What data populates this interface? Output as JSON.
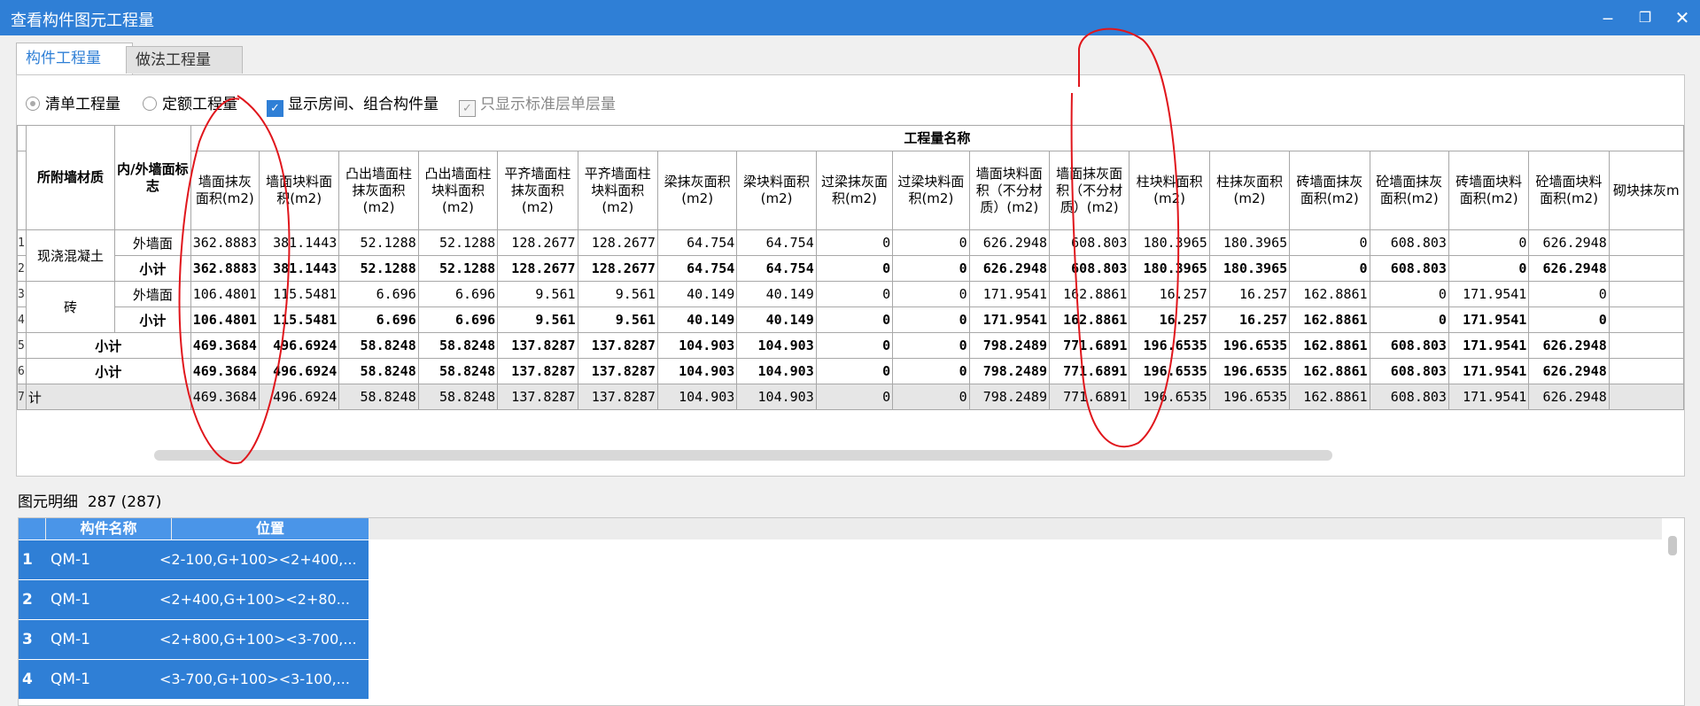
{
  "window": {
    "title": "查看构件图元工程量"
  },
  "tabs": [
    {
      "label": "构件工程量",
      "active": true
    },
    {
      "label": "做法工程量",
      "active": false
    }
  ],
  "options": {
    "radio1": "清单工程量",
    "radio2": "定额工程量",
    "check1": "显示房间、组合构件量",
    "check2": "只显示标准层单层量"
  },
  "table": {
    "group_header": "工程量名称",
    "col_material": "所附墙材质",
    "col_side": "内/外墙面标志",
    "columns": [
      "墙面抹灰面积(m2)",
      "墙面块料面积(m2)",
      "凸出墙面柱抹灰面积(m2)",
      "凸出墙面柱块料面积(m2)",
      "平齐墙面柱抹灰面积(m2)",
      "平齐墙面柱块料面积(m2)",
      "梁抹灰面积(m2)",
      "梁块料面积(m2)",
      "过梁抹灰面积(m2)",
      "过梁块料面积(m2)",
      "墙面块料面积（不分材质）(m2)",
      "墙面抹灰面积（不分材质）(m2)",
      "柱块料面积(m2)",
      "柱抹灰面积(m2)",
      "砖墙面抹灰面积(m2)",
      "砼墙面抹灰面积(m2)",
      "砖墙面块料面积(m2)",
      "砼墙面块料面积(m2)",
      "砌块抹灰m"
    ],
    "rows": [
      {
        "n": "1",
        "material": "现浇混凝土",
        "side": "外墙面",
        "values": [
          "362.8883",
          "381.1443",
          "52.1288",
          "52.1288",
          "128.2677",
          "128.2677",
          "64.754",
          "64.754",
          "0",
          "0",
          "626.2948",
          "608.803",
          "180.3965",
          "180.3965",
          "0",
          "608.803",
          "0",
          "626.2948",
          ""
        ]
      },
      {
        "n": "2",
        "material": "",
        "side": "小计",
        "values": [
          "362.8883",
          "381.1443",
          "52.1288",
          "52.1288",
          "128.2677",
          "128.2677",
          "64.754",
          "64.754",
          "0",
          "0",
          "626.2948",
          "608.803",
          "180.3965",
          "180.3965",
          "0",
          "608.803",
          "0",
          "626.2948",
          ""
        ]
      },
      {
        "n": "3",
        "material": "砖",
        "side": "外墙面",
        "values": [
          "106.4801",
          "115.5481",
          "6.696",
          "6.696",
          "9.561",
          "9.561",
          "40.149",
          "40.149",
          "0",
          "0",
          "171.9541",
          "162.8861",
          "16.257",
          "16.257",
          "162.8861",
          "0",
          "171.9541",
          "0",
          ""
        ]
      },
      {
        "n": "4",
        "material": "",
        "side": "小计",
        "values": [
          "106.4801",
          "115.5481",
          "6.696",
          "6.696",
          "9.561",
          "9.561",
          "40.149",
          "40.149",
          "0",
          "0",
          "171.9541",
          "162.8861",
          "16.257",
          "16.257",
          "162.8861",
          "0",
          "171.9541",
          "0",
          ""
        ]
      },
      {
        "n": "5",
        "label": "小计",
        "values": [
          "469.3684",
          "496.6924",
          "58.8248",
          "58.8248",
          "137.8287",
          "137.8287",
          "104.903",
          "104.903",
          "0",
          "0",
          "798.2489",
          "771.6891",
          "196.6535",
          "196.6535",
          "162.8861",
          "608.803",
          "171.9541",
          "626.2948",
          ""
        ]
      },
      {
        "n": "6",
        "label": "小计",
        "values": [
          "469.3684",
          "496.6924",
          "58.8248",
          "58.8248",
          "137.8287",
          "137.8287",
          "104.903",
          "104.903",
          "0",
          "0",
          "798.2489",
          "771.6891",
          "196.6535",
          "196.6535",
          "162.8861",
          "608.803",
          "171.9541",
          "626.2948",
          ""
        ]
      },
      {
        "n": "7",
        "label": "计",
        "values": [
          "469.3684",
          "496.6924",
          "58.8248",
          "58.8248",
          "137.8287",
          "137.8287",
          "104.903",
          "104.903",
          "0",
          "0",
          "798.2489",
          "771.6891",
          "196.6535",
          "196.6535",
          "162.8861",
          "608.803",
          "171.9541",
          "626.2948",
          ""
        ]
      }
    ]
  },
  "detail": {
    "label": "图元明细",
    "count": "287 (287)",
    "headers": [
      "构件名称",
      "位置"
    ],
    "rows": [
      {
        "n": "1",
        "name": "QM-1",
        "pos": "<2-100,G+100><2+400,..."
      },
      {
        "n": "2",
        "name": "QM-1",
        "pos": "<2+400,G+100><2+80..."
      },
      {
        "n": "3",
        "name": "QM-1",
        "pos": "<2+800,G+100><3-700,..."
      },
      {
        "n": "4",
        "name": "QM-1",
        "pos": "<3-700,G+100><3-100,..."
      }
    ]
  },
  "colors": {
    "accent": "#2f7fd6",
    "annotation": "#e0161c"
  }
}
